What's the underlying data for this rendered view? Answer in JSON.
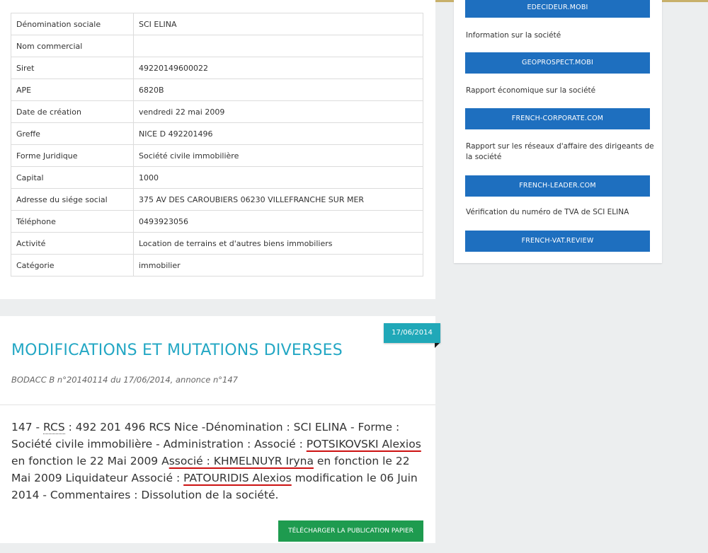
{
  "company_info": {
    "rows": [
      {
        "label": "Dénomination sociale",
        "value": "SCI ELINA"
      },
      {
        "label": "Nom commercial",
        "value": ""
      },
      {
        "label": "Siret",
        "value": "49220149600022"
      },
      {
        "label": "APE",
        "value": "6820B"
      },
      {
        "label": "Date de création",
        "value": "vendredi 22 mai 2009"
      },
      {
        "label": "Greffe",
        "value": "NICE D 492201496"
      },
      {
        "label": "Forme Juridique",
        "value": "Société civile immobilière"
      },
      {
        "label": "Capital",
        "value": "1000"
      },
      {
        "label": "Adresse du siége social",
        "value": "375 AV DES CAROUBIERS 06230 VILLEFRANCHE SUR MER"
      },
      {
        "label": "Téléphone",
        "value": "0493923056"
      },
      {
        "label": "Activité",
        "value": "Location de terrains et d'autres biens immobiliers"
      },
      {
        "label": "Catégorie",
        "value": "immobilier"
      }
    ]
  },
  "sidebar": {
    "btn_edecideur": "EDECIDEUR.MOBI",
    "text_info": "Information sur la société",
    "btn_geoprospect": "GEOPROSPECT.MOBI",
    "text_rapport": "Rapport économique sur la société",
    "btn_french_corporate": "FRENCH-CORPORATE.COM",
    "text_reseaux": "Rapport sur les réseaux d'affaire des dirigeants de la société",
    "btn_french_leader": "FRENCH-LEADER.COM",
    "text_tva": "Vérification du numéro de TVA de SCI ELINA",
    "btn_french_vat": "FRENCH-VAT.REVIEW"
  },
  "publication": {
    "date_badge": "17/06/2014",
    "title": "MODIFICATIONS ET MUTATIONS DIVERSES",
    "reference": "BODACC B n°20140114 du 17/06/2014, annonce n°147",
    "body": {
      "part1": "147 - ",
      "rcs": "RCS",
      "part2": " : 492 201 496 RCS Nice -Dénomination : SCI ELINA - Forme : Société civile immobilière - Administration : Associé : ",
      "name1": "POTSIKOVSKI Alexios",
      "part3": " en fonction le 22 Mai 2009 A",
      "name2": "ssocié : KHMELNUYR Iryna",
      "part4": " en fonction le 22 Mai 2009 Liquidateur Associé : ",
      "name3": "PATOURIDIS Alexios",
      "part5": " modification le 06 Juin 2014 - Commentaires : Dissolution de la société."
    },
    "download_label": "TÉLÉCHARGER LA PUBLICATION PAPIER"
  }
}
